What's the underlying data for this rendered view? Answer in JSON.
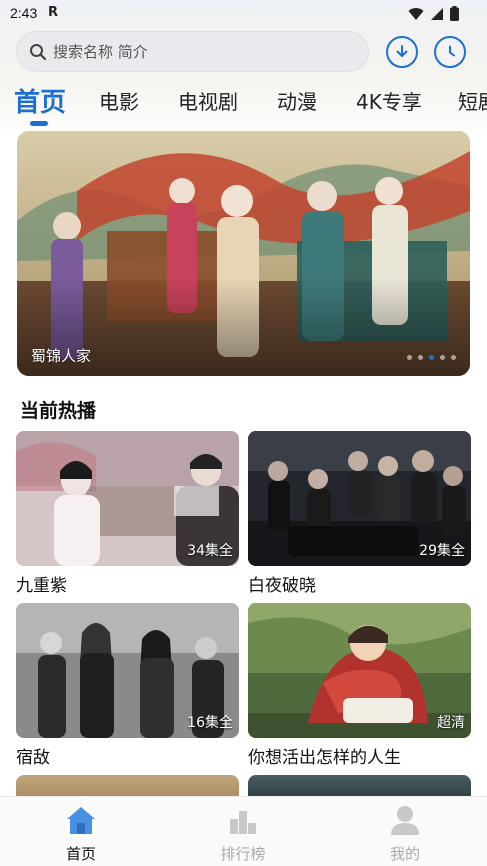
{
  "status_bar": {
    "time": "2:43",
    "extra": "R"
  },
  "search": {
    "placeholder": "搜索名称 简介"
  },
  "header_icons": [
    "download-icon",
    "history-icon"
  ],
  "tabs": [
    {
      "label": "首页",
      "active": true
    },
    {
      "label": "电影"
    },
    {
      "label": "电视剧"
    },
    {
      "label": "动漫"
    },
    {
      "label": "4K专享"
    },
    {
      "label": "短剧"
    }
  ],
  "banner": {
    "caption": "蜀锦人家",
    "dots": 5,
    "active_dot": 2
  },
  "section": {
    "title": "当前热播"
  },
  "cards": [
    {
      "title": "九重紫",
      "badge": "34集全"
    },
    {
      "title": "白夜破晓",
      "badge": "29集全"
    },
    {
      "title": "宿敌",
      "badge": "16集全"
    },
    {
      "title": "你想活出怎样的人生",
      "badge": "超清"
    }
  ],
  "bottom_nav": [
    {
      "label": "首页",
      "icon": "home-icon",
      "active": true
    },
    {
      "label": "排行榜",
      "icon": "ranking-icon"
    },
    {
      "label": "我的",
      "icon": "profile-icon"
    }
  ],
  "colors": {
    "accent": "#1e6fd0",
    "inactive": "#aaaaaa"
  }
}
